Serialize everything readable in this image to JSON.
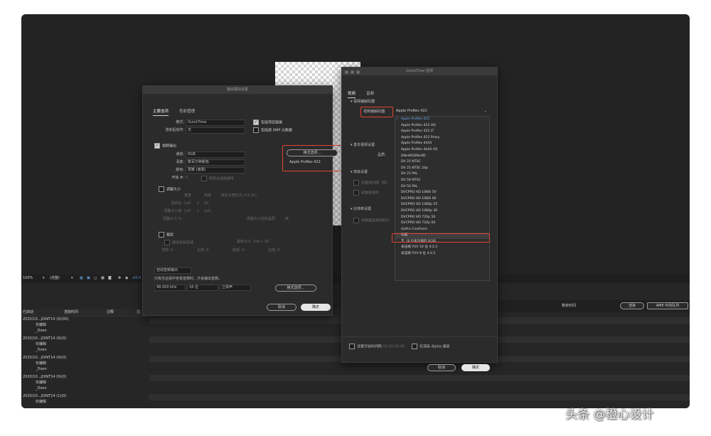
{
  "toolbar": {
    "zoom": "100%",
    "view": "(完整)",
    "exposure": "+0.0"
  },
  "timeline": {
    "headers": [
      "已启动",
      "渲染时间",
      "注释",
      "注"
    ],
    "rows": [
      {
        "file": "2020/10...JOINT14 (9)(00)",
        "settings": "仅编辑",
        "output": "_Doen"
      },
      {
        "file": "2020/10...JOINT14 (9)(0)",
        "settings": "仅编辑",
        "output": "_Doen"
      },
      {
        "file": "2020/10...JOINT14 (9)(0)",
        "settings": "仅编辑",
        "output": "_Doen"
      },
      {
        "file": "2020/10...JOINT14 (9)(0)",
        "settings": "仅编辑",
        "output": "_Doen"
      },
      {
        "file": "2020/10...JOINT14 (1)(0)",
        "settings": "仅编辑",
        "output": "_Doen"
      }
    ],
    "render_label": "剩余时间",
    "render_button": "渲染",
    "ame_button": "AME 中的队列"
  },
  "output_dialog": {
    "title": "输出模块设置",
    "tabs": [
      "主要选项",
      "色彩管理"
    ],
    "format_label": "格式:",
    "format_value": "QuickTime",
    "post_label": "渲染后动作:",
    "post_value": "无",
    "include_project": "包括项目链接",
    "include_xmp": "包括源 XMP 元数据",
    "video_output": "视频输出",
    "channel_label": "通道:",
    "channel_value": "RGB",
    "depth_label": "深度:",
    "depth_value": "数百万种颜色",
    "color_label": "颜色:",
    "color_value": "预乘 (遮罩)",
    "start_label": "开始 #:",
    "start_value": "0",
    "use_comp_frame": "使用合成帧编号",
    "format_options_btn": "格式选项...",
    "codec_summary": "Apple ProRes 422",
    "resize": "调整大小",
    "resize_cols": [
      "宽度",
      "高度",
      "锁定长宽比为 (11:20)"
    ],
    "render_at_label": "渲染在:",
    "render_at": [
      "1x0",
      "x",
      "20"
    ],
    "resize_to_label": "调整大小到:",
    "resize_to": [
      "1x0",
      "x",
      "1x0"
    ],
    "resize_pct_label": "调整大小 %:",
    "resize_quality_label": "调整大小后的品质:",
    "resize_quality_value": "高",
    "crop": "裁剪",
    "use_roi": "使用目标区域",
    "final_size": "最终大小: 20x x 20",
    "crop_fields": [
      "顶部: 0",
      "左侧: 0",
      "底部: 0",
      "右侧: 0"
    ],
    "auto_audio": "自动音频输出",
    "audio_note": "只有当合成中含有音频时，才会输出音频。",
    "sample_rate": "48.000 kHz",
    "bit_depth": "16 位",
    "channels": "立体声",
    "cancel": "取消",
    "ok": "确定"
  },
  "qt_dialog": {
    "title": "QuickTime 选项",
    "tabs": [
      "视频",
      "音频"
    ],
    "codec_section": "视频编解码器",
    "codec_label": "视频编解码器:",
    "codec_value": "Apple ProRes 422",
    "basic_section": "基本视频设置",
    "quality_label": "品质:",
    "advanced_section": "高级设置",
    "keyframe": "关键帧间隔（帧）",
    "frame_reorder": "帧重新排序",
    "bitrate_section": "比特率设置",
    "limit_bitrate": "将数据速率限制为",
    "codec_options": [
      "Apple ProRes 422",
      "Apple ProRes 422 HQ",
      "Apple ProRes 422 LT",
      "Apple ProRes 422 Proxy",
      "Apple ProRes 4444",
      "Apple ProRes 4444 XQ",
      "DNxHR/DNxHD",
      "DV 25 NTSC",
      "DV 25 NTSC 24p",
      "DV 25 PAL",
      "DV 50 NTSC",
      "DV 50 PAL",
      "DVCPRO HD 1080i 50",
      "DVCPRO HD 1080i 60",
      "DVCPRO HD 1080p 25",
      "DVCPRO HD 1080p 30",
      "DVCPRO HD 720p 50",
      "DVCPRO HD 720p 60",
      "GoPro CineForm",
      "动画",
      "无（8 位未压缩的 RGB）",
      "未压缩 YUV 10 位 4:2:2",
      "未压缩 YUV 8 位 4:2:2"
    ],
    "set_start_tc": "设置开始时间码",
    "start_tc_value": "00:00:00:00",
    "alpha_only": "仅渲染 Alpha 通道",
    "cancel": "取消",
    "ok": "确定"
  },
  "watermark": "头条 @橙心设计",
  "colors": {
    "highlight": "#e0452c",
    "selected": "#6aaaf0",
    "background": "#232323"
  }
}
